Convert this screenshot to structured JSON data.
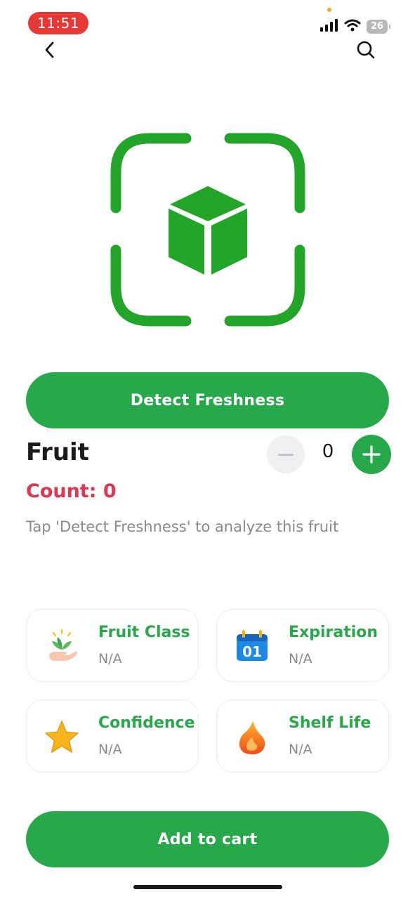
{
  "status_bar": {
    "time": "11:51",
    "battery": "26",
    "icons": [
      "signal-icon",
      "wifi-icon",
      "battery-icon"
    ]
  },
  "header": {
    "back_icon": "chevron-left-icon",
    "search_icon": "search-icon"
  },
  "hero": {
    "icon": "scan-cube-icon"
  },
  "detect_button": {
    "label": "Detect Freshness"
  },
  "product": {
    "title": "Fruit",
    "quantity": "0",
    "count_label": "Count: 0",
    "hint": "Tap 'Detect Freshness' to analyze this fruit"
  },
  "cards": [
    {
      "label": "Fruit Class",
      "value": "N/A",
      "icon": "plant-hand-icon"
    },
    {
      "label": "Expiration",
      "value": "N/A",
      "icon": "calendar-icon",
      "icon_text": "01"
    },
    {
      "label": "Confidence",
      "value": "N/A",
      "icon": "star-icon"
    },
    {
      "label": "Shelf Life",
      "value": "N/A",
      "icon": "flame-icon"
    }
  ],
  "cart_button": {
    "label": "Add to cart"
  },
  "colors": {
    "primary": "#27a84a",
    "accent_red": "#e0364f",
    "time_badge": "#e53935",
    "muted_text": "#8a8a8a"
  }
}
